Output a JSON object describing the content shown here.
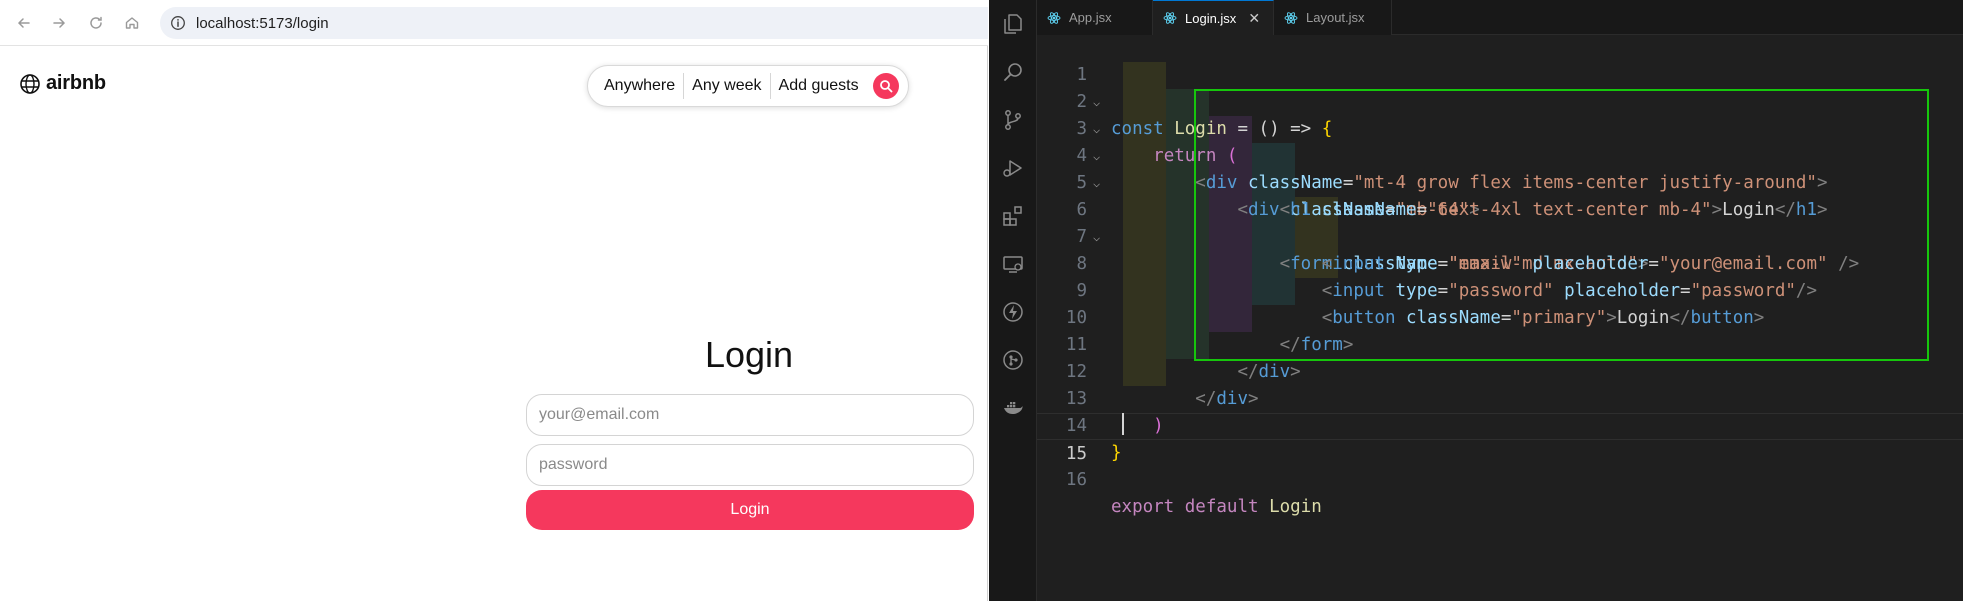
{
  "browser": {
    "url": "localhost:5173/login",
    "logo_text": "airbnb",
    "search": {
      "segments": [
        "Anywhere",
        "Any week",
        "Add guests"
      ]
    },
    "login": {
      "title": "Login",
      "email_placeholder": "your@email.com",
      "password_placeholder": "password",
      "button_label": "Login"
    },
    "accent_color": "#f5385d"
  },
  "editor": {
    "tabs": [
      {
        "label": "App.jsx",
        "active": false
      },
      {
        "label": "Login.jsx",
        "active": true
      },
      {
        "label": "Layout.jsx",
        "active": false
      }
    ],
    "close_glyph": "✕",
    "line_numbers": [
      "1",
      "2",
      "3",
      "4",
      "5",
      "6",
      "7",
      "8",
      "9",
      "10",
      "11",
      "12",
      "13",
      "14",
      "15",
      "16"
    ],
    "code": {
      "l1": {
        "kw": "const",
        "name": "Login",
        "rest": "= () =>",
        "brace": "{"
      },
      "l2": {
        "kw": "return",
        "paren": "("
      },
      "l3": {
        "tag": "div",
        "attr": "className",
        "value": "\"mt-4 grow flex items-center justify-around\""
      },
      "l4": {
        "tag": "div",
        "attr": "className",
        "value": "\"mb-64\""
      },
      "l5": {
        "tag": "h1",
        "attr": "className",
        "value": "\"text-4xl text-center mb-4\"",
        "text": "Login",
        "close": "h1"
      },
      "l6": {
        "tag": "form",
        "attr": "className",
        "value": "\"max-w-md mx-auto\""
      },
      "l7": {
        "tag": "input",
        "attr1": "type",
        "value1": "\"email\"",
        "attr2": "placeholder",
        "value2": "\"your@email.com\""
      },
      "l8": {
        "tag": "input",
        "attr1": "type",
        "value1": "\"password\"",
        "attr2": "placeholder",
        "value2": "\"password\""
      },
      "l9": {
        "tag": "button",
        "attr": "className",
        "value": "\"primary\"",
        "text": "Login",
        "close": "button"
      },
      "l10": {
        "close": "form"
      },
      "l11": {
        "close": "div"
      },
      "l12": {
        "close": "div"
      },
      "l13": {
        "paren": ")"
      },
      "l14": {
        "brace": "}"
      },
      "l16": {
        "kw1": "export",
        "kw2": "default",
        "name": "Login"
      }
    },
    "highlight_color": "#16c60c"
  }
}
